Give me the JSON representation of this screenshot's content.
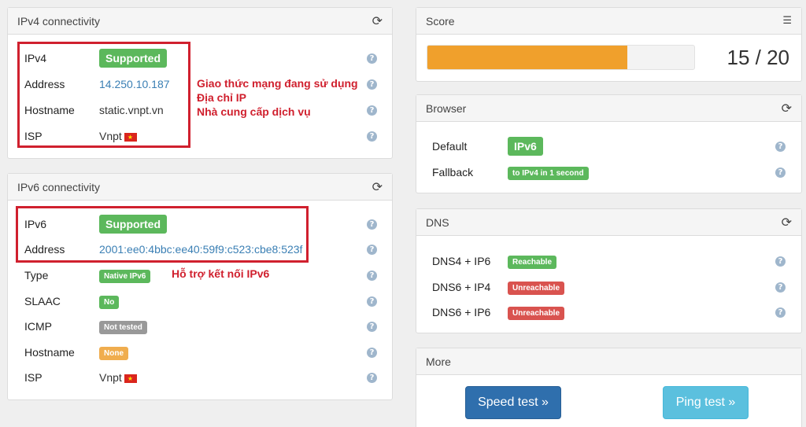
{
  "ipv4": {
    "title": "IPv4 connectivity",
    "rows": [
      {
        "label": "IPv4",
        "value": "Supported"
      },
      {
        "label": "Address",
        "value": "14.250.10.187"
      },
      {
        "label": "Hostname",
        "value": "static.vnpt.vn"
      },
      {
        "label": "ISP",
        "value": "Vnpt"
      }
    ],
    "annotations": [
      "Giao thức mạng đang sử dụng",
      "Địa chỉ IP",
      "Nhà cung cấp dịch vụ"
    ]
  },
  "ipv6": {
    "title": "IPv6 connectivity",
    "rows": [
      {
        "label": "IPv6",
        "value": "Supported"
      },
      {
        "label": "Address",
        "value": "2001:ee0:4bbc:ee40:59f9:c523:cbe8:523f"
      },
      {
        "label": "Type",
        "value": "Native IPv6"
      },
      {
        "label": "SLAAC",
        "value": "No"
      },
      {
        "label": "ICMP",
        "value": "Not tested"
      },
      {
        "label": "Hostname",
        "value": "None"
      },
      {
        "label": "ISP",
        "value": "Vnpt"
      }
    ],
    "annotation": "Hỗ trợ kết nối IPv6"
  },
  "score": {
    "title": "Score",
    "text": "15 / 20",
    "fraction": 0.75
  },
  "browser": {
    "title": "Browser",
    "rows": [
      {
        "label": "Default",
        "value": "IPv6"
      },
      {
        "label": "Fallback",
        "value": "to IPv4 in 1 second"
      }
    ]
  },
  "dns": {
    "title": "DNS",
    "rows": [
      {
        "label": "DNS4 + IP6",
        "value": "Reachable"
      },
      {
        "label": "DNS6 + IP4",
        "value": "Unreachable"
      },
      {
        "label": "DNS6 + IP6",
        "value": "Unreachable"
      }
    ]
  },
  "more": {
    "title": "More",
    "speed_test": "Speed test »",
    "ping_test": "Ping test »"
  },
  "icons": {
    "refresh": "⟳",
    "list": "☰",
    "help": "?"
  },
  "colors": {
    "success": "#5cb85c",
    "danger": "#d9534f",
    "muted": "#999999",
    "warning": "#f0ad4e",
    "score_fill": "#f0a02c",
    "annotation": "#d0202e",
    "speed_button": "#2f6fad",
    "ping_button": "#5bc0de"
  }
}
